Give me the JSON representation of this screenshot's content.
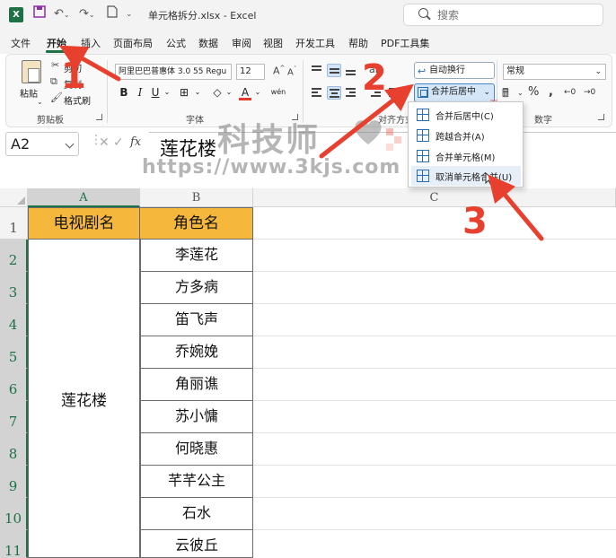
{
  "titlebar": {
    "doc_title": "单元格拆分.xlsx - Excel",
    "search_placeholder": "搜索",
    "app_logo": "X"
  },
  "tabs": [
    "文件",
    "开始",
    "插入",
    "页面布局",
    "公式",
    "数据",
    "审阅",
    "视图",
    "开发工具",
    "帮助",
    "PDF工具集"
  ],
  "active_tab": "开始",
  "ribbon": {
    "clipboard": {
      "paste": "粘贴",
      "cut": "剪切",
      "copy": "复制",
      "format_painter": "格式刷",
      "group_label": "剪贴板"
    },
    "font": {
      "font_name": "阿里巴巴普惠体 3.0 55 Regu",
      "font_size": "12",
      "group_label": "字体"
    },
    "alignment": {
      "wrap_text": "自动换行",
      "merge_center": "合并后居中",
      "group_label": "对齐方式"
    },
    "number": {
      "format": "常规",
      "group_label": "数字"
    }
  },
  "merge_menu": {
    "items": [
      "合并后居中(C)",
      "跨越合并(A)",
      "合并单元格(M)",
      "取消单元格合并(U)"
    ],
    "hovered_index": 3
  },
  "formula_bar": {
    "name_box": "A2",
    "fx": "fx",
    "value": "莲花楼"
  },
  "watermark": {
    "text": "科技师",
    "url": "https://www.3kjs.com"
  },
  "sheet": {
    "columns": [
      "A",
      "B",
      "C"
    ],
    "rows": [
      "1",
      "2",
      "3",
      "4",
      "5",
      "6",
      "7",
      "8",
      "9",
      "10",
      "11"
    ],
    "header_row": [
      "电视剧名",
      "角色名"
    ],
    "merged_a": "莲花楼",
    "col_b_values": [
      "李莲花",
      "方多病",
      "笛飞声",
      "乔婉娩",
      "角丽谯",
      "苏小慵",
      "何晓惠",
      "芊芊公主",
      "石水",
      "云彼丘"
    ]
  },
  "annotations": [
    "1",
    "2",
    "3"
  ],
  "colors": {
    "excel_green": "#1e7145",
    "header_fill": "#f5b83d",
    "annotation_red": "#e8402f",
    "menu_hover": "#e6eef7"
  }
}
